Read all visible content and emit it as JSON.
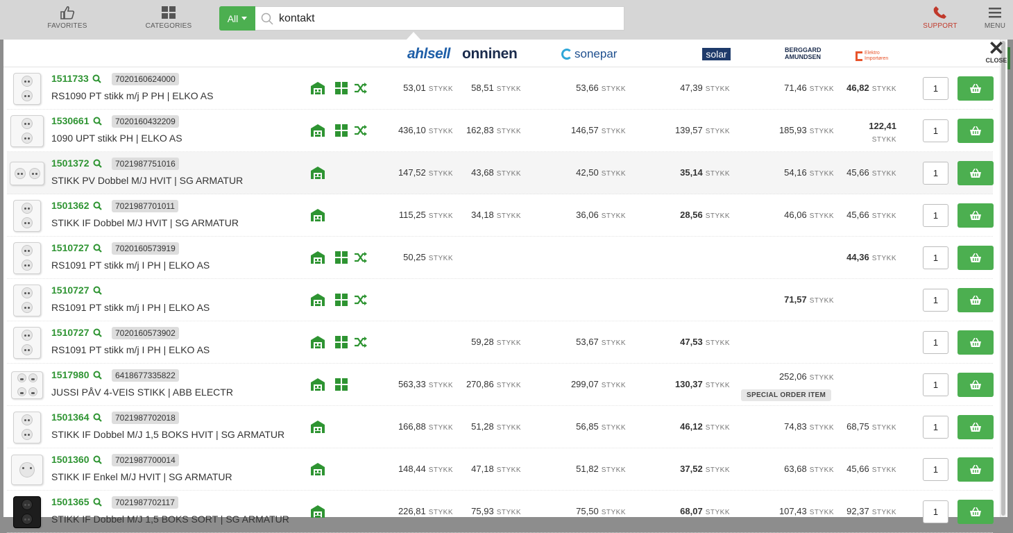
{
  "topbar": {
    "favorites_label": "FAVORITES",
    "categories_label": "CATEGORIES",
    "support_label": "SUPPORT",
    "menu_label": "MENU",
    "scope_label": "All",
    "search_value": "kontakt"
  },
  "header": {
    "close_label": "CLOSE",
    "suppliers": {
      "ahlsell": "ahlsell",
      "onninen": "onninen",
      "sonepar": "sonepar",
      "solar": "solar",
      "berggard_line1": "BERGGARD",
      "berggard_line2": "AMUNDSEN",
      "elektro_line1": "Elektro",
      "elektro_line2": "Importøren"
    }
  },
  "unit": "STYKK",
  "special_order_label": "SPECIAL ORDER ITEM",
  "colors": {
    "accent": "#4caf50",
    "link": "#2e9432",
    "support": "#c0392b"
  },
  "rows": [
    {
      "art": "1511733",
      "ean": "7020160624000",
      "desc": "RS1090 PT stikk m/j P PH | ELKO AS",
      "qty": "1",
      "p1": "53,01",
      "p2": "58,51",
      "p3": "53,66",
      "p4": "47,39",
      "p5": "71,46",
      "p6": "46,82"
    },
    {
      "art": "1530661",
      "ean": "7020160432209",
      "desc": "1090 UPT stikk PH | ELKO AS",
      "qty": "1",
      "p1": "436,10",
      "p2": "162,83",
      "p3": "146,57",
      "p4": "139,57",
      "p5": "185,93",
      "p6": "122,41"
    },
    {
      "art": "1501372",
      "ean": "7021987751016",
      "desc": "STIKK PV Dobbel M/J HVIT | SG ARMATUR",
      "qty": "1",
      "p1": "147,52",
      "p2": "43,68",
      "p3": "42,50",
      "p4": "35,14",
      "p5": "54,16",
      "p6": "45,66"
    },
    {
      "art": "1501362",
      "ean": "7021987701011",
      "desc": "STIKK IF Dobbel M/J HVIT | SG ARMATUR",
      "qty": "1",
      "p1": "115,25",
      "p2": "34,18",
      "p3": "36,06",
      "p4": "28,56",
      "p5": "46,06",
      "p6": "45,66"
    },
    {
      "art": "1510727",
      "ean": "7020160573919",
      "desc": "RS1091 PT stikk m/j I PH | ELKO AS",
      "qty": "1",
      "p1": "50,25",
      "p6": "44,36"
    },
    {
      "art": "1510727",
      "desc": "RS1091 PT stikk m/j I PH | ELKO AS",
      "qty": "1",
      "p5": "71,57"
    },
    {
      "art": "1510727",
      "ean": "7020160573902",
      "desc": "RS1091 PT stikk m/j I PH | ELKO AS",
      "qty": "1",
      "p2": "59,28",
      "p3": "53,67",
      "p4": "47,53"
    },
    {
      "art": "1517980",
      "ean": "6418677335822",
      "desc": "JUSSI PÅV 4-VEIS STIKK | ABB ELECTR",
      "qty": "1",
      "p1": "563,33",
      "p2": "270,86",
      "p3": "299,07",
      "p4": "130,37",
      "p5": "252,06"
    },
    {
      "art": "1501364",
      "ean": "7021987702018",
      "desc": "STIKK IF Dobbel M/J 1,5 BOKS HVIT | SG ARMATUR",
      "qty": "1",
      "p1": "166,88",
      "p2": "51,28",
      "p3": "56,85",
      "p4": "46,12",
      "p5": "74,83",
      "p6": "68,75"
    },
    {
      "art": "1501360",
      "ean": "7021987700014",
      "desc": "STIKK IF Enkel M/J HVIT | SG ARMATUR",
      "qty": "1",
      "p1": "148,44",
      "p2": "47,18",
      "p3": "51,82",
      "p4": "37,52",
      "p5": "63,68",
      "p6": "45,66"
    },
    {
      "art": "1501365",
      "ean": "7021987702117",
      "desc": "STIKK IF Dobbel M/J 1,5 BOKS SORT | SG ARMATUR",
      "qty": "1",
      "p1": "226,81",
      "p2": "75,93",
      "p3": "75,50",
      "p4": "68,07",
      "p5": "107,43",
      "p6": "92,37"
    }
  ]
}
